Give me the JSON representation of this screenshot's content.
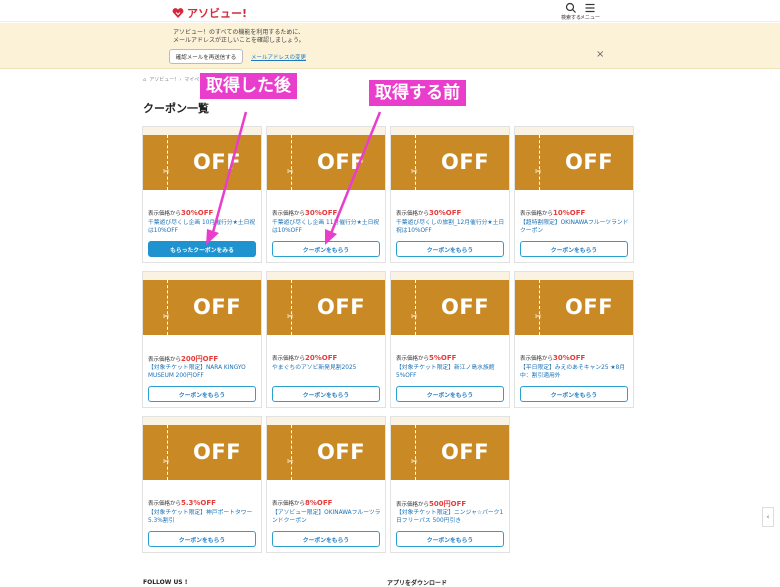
{
  "header": {
    "logo_text": "アソビュー!",
    "search_label": "検索する",
    "menu_label": "メニュー"
  },
  "notice": {
    "line1": "アソビュー！のすべての機能を利用するために、",
    "line2": "メールアドレスが正しいことを確認しましょう。",
    "resend_label": "確認メールを再送信する",
    "change_link": "メールアドレスの変更",
    "close": "×"
  },
  "breadcrumb": [
    "アソビュー!",
    "マイページ"
  ],
  "page_title": "クーポン一覧",
  "annotations": {
    "after": "取得した後",
    "before": "取得する前"
  },
  "coupon_common": {
    "off_text": "OFF",
    "rate_prefix": "表示価格から",
    "get_label": "クーポンをもらう",
    "got_label": "もらったクーポンをみる"
  },
  "coupons": [
    {
      "rate": "30%OFF",
      "desc": "千葉遊び尽くし企画 10月催行分★土日祝は10%OFF",
      "obtained": true
    },
    {
      "rate": "30%OFF",
      "desc": "千葉遊び尽くし企画 11月催行分★土日祝は10%OFF",
      "obtained": false
    },
    {
      "rate": "30%OFF",
      "desc": "千葉遊び尽くしの旅割_12月催行分★土日祝は10%OFF",
      "obtained": false
    },
    {
      "rate": "10%OFF",
      "desc": "【超特割限定】OKINAWAフルーツランドクーポン",
      "obtained": false
    },
    {
      "rate": "200円OFF",
      "desc": "【対象チケット限定】NARA KINGYO MUSEUM 200円OFF",
      "obtained": false
    },
    {
      "rate": "20%OFF",
      "desc": "やまぐちのアソビ新発見割2025",
      "obtained": false
    },
    {
      "rate": "5%OFF",
      "desc": "【対象チケット限定】新江ノ島水族館5%OFF",
      "obtained": false
    },
    {
      "rate": "30%OFF",
      "desc": "【平日限定】みえのあそキャン25 ★8月中：割引適用外",
      "obtained": false
    },
    {
      "rate": "5.3%OFF",
      "desc": "【対象チケット限定】神戸ポートタワー5.3%割引",
      "obtained": false
    },
    {
      "rate": "8%OFF",
      "desc": "【アソビュー限定】OKINAWAフルーツランドクーポン",
      "obtained": false
    },
    {
      "rate": "500円OFF",
      "desc": "【対象チケット限定】ニンジャ☆パーク1日フリーパス 500円引き",
      "obtained": false
    }
  ],
  "footer": {
    "follow": "FOLLOW US !",
    "app": "アプリをダウンロード"
  },
  "colors": {
    "ticket": "#c98a26",
    "annotation": "#e83ecb",
    "button_blue": "#1f93cf",
    "notice_bg": "#fbf2d8",
    "discount_red": "#e73b3b"
  }
}
